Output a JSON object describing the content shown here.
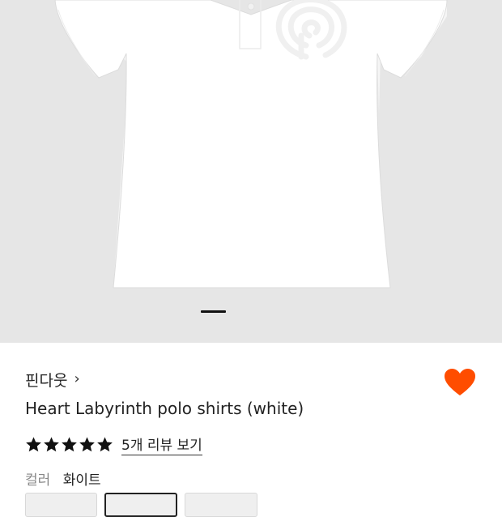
{
  "product": {
    "brand": "핀다웃",
    "brand_chevron": "›",
    "title": "Heart Labyrinth polo shirts (white)",
    "rating_stars": 5,
    "review_link": "5개 리뷰 보기",
    "color_label": "컬러",
    "color_value": "화이트",
    "liked": true
  },
  "gallery": {
    "pager_active_index": 0
  },
  "colors": {
    "accent": "#ff4d00",
    "hero_bg": "#e6e6e6",
    "star": "#111111"
  },
  "icons": {
    "brand_chevron": "chevron-right-icon",
    "wishlist": "heart-icon",
    "star": "star-icon"
  }
}
